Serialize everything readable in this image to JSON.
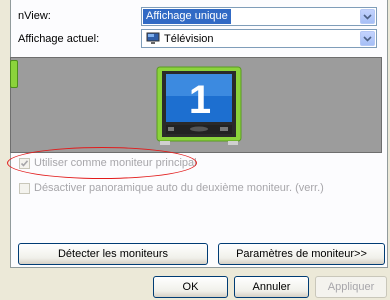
{
  "nview": {
    "label": "nView:",
    "value": "Affichage unique"
  },
  "display": {
    "label": "Affichage actuel:",
    "value": "Télévision"
  },
  "monitor_number": "1",
  "options": {
    "primary_label": "Utiliser comme moniteur principal",
    "primary_checked": true,
    "auto_pan_label": "Désactiver panoramique auto du deuxième moniteur. (verr.)",
    "auto_pan_checked": false
  },
  "buttons": {
    "detect": "Détecter les moniteurs",
    "settings": "Paramètres de moniteur>>",
    "ok": "OK",
    "cancel": "Annuler",
    "apply": "Appliquer"
  },
  "colors": {
    "selection": "#316ac5",
    "preview_bg": "#9c9c9c",
    "monitor_frame": "#8bd33b",
    "annotation": "#e21b1b"
  }
}
